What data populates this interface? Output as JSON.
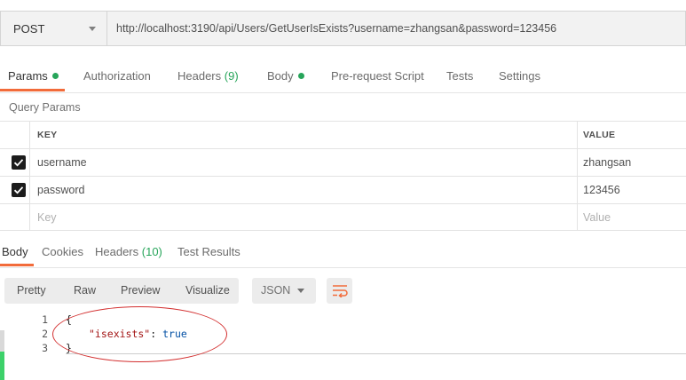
{
  "request": {
    "method": "POST",
    "url": "http://localhost:3190/api/Users/GetUserIsExists?username=zhangsan&password=123456"
  },
  "request_tabs": {
    "params": "Params",
    "authorization": "Authorization",
    "headers": "Headers",
    "headers_count": "(9)",
    "body": "Body",
    "pre_request_script": "Pre-request Script",
    "tests": "Tests",
    "settings": "Settings"
  },
  "query_params": {
    "title": "Query Params",
    "columns": {
      "key": "KEY",
      "value": "VALUE"
    },
    "rows": [
      {
        "key": "username",
        "value": "zhangsan",
        "checked": true
      },
      {
        "key": "password",
        "value": "123456",
        "checked": true
      }
    ],
    "placeholder": {
      "key": "Key",
      "value": "Value"
    }
  },
  "response_tabs": {
    "body": "Body",
    "cookies": "Cookies",
    "headers": "Headers",
    "headers_count": "(10)",
    "test_results": "Test Results"
  },
  "response_toolbar": {
    "pretty": "Pretty",
    "raw": "Raw",
    "preview": "Preview",
    "visualize": "Visualize",
    "format": "JSON",
    "wrap_icon": "wrap-lines-icon"
  },
  "response_body": {
    "lines": [
      {
        "no": "1",
        "open": "{"
      },
      {
        "no": "2",
        "key": "\"isexists\"",
        "sep": ": ",
        "value": "true"
      },
      {
        "no": "3",
        "close": "}"
      }
    ]
  },
  "colors": {
    "accent": "#f26b3a",
    "status_green": "#27a55a",
    "annotation": "#d32f2f"
  }
}
